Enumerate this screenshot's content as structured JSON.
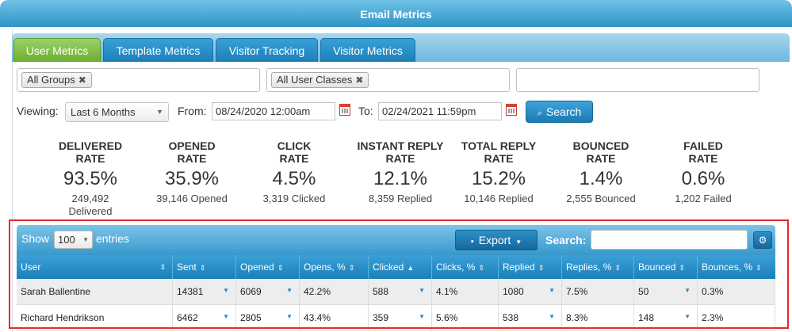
{
  "window": {
    "title": "Email Metrics"
  },
  "tabs": [
    {
      "label": "User Metrics",
      "active": true
    },
    {
      "label": "Template Metrics",
      "active": false
    },
    {
      "label": "Visitor Tracking",
      "active": false
    },
    {
      "label": "Visitor Metrics",
      "active": false
    }
  ],
  "filters": {
    "groups_chip": "All Groups",
    "user_classes_chip": "All User Classes",
    "chip_remove": "✖",
    "third": ""
  },
  "viewing": {
    "label": "Viewing:",
    "selected": "Last 6 Months",
    "from_label": "From:",
    "from_value": "08/24/2020 12:00am",
    "to_label": "To:",
    "to_value": "02/24/2021 11:59pm",
    "search_label": "Search"
  },
  "metrics": [
    {
      "title1": "DELIVERED",
      "title2": "RATE",
      "value": "93.5%",
      "count1": "249,492",
      "count2": "Delivered"
    },
    {
      "title1": "OPENED",
      "title2": "RATE",
      "value": "35.9%",
      "count1": "39,146 Opened",
      "count2": ""
    },
    {
      "title1": "CLICK",
      "title2": "RATE",
      "value": "4.5%",
      "count1": "3,319 Clicked",
      "count2": ""
    },
    {
      "title1": "INSTANT REPLY",
      "title2": "RATE",
      "value": "12.1%",
      "count1": "8,359 Replied",
      "count2": ""
    },
    {
      "title1": "TOTAL REPLY",
      "title2": "RATE",
      "value": "15.2%",
      "count1": "10,146 Replied",
      "count2": ""
    },
    {
      "title1": "BOUNCED",
      "title2": "RATE",
      "value": "1.4%",
      "count1": "2,555 Bounced",
      "count2": ""
    },
    {
      "title1": "FAILED",
      "title2": "RATE",
      "value": "0.6%",
      "count1": "1,202 Failed",
      "count2": ""
    }
  ],
  "table": {
    "show_label": "Show",
    "page_size": "100",
    "entries_label": "entries",
    "export_label": "Export",
    "search_label": "Search:",
    "search_value": "",
    "columns": [
      "User",
      "Sent",
      "Opened",
      "Opens, %",
      "Clicked",
      "Clicks, %",
      "Replied",
      "Replies, %",
      "Bounced",
      "Bounces, %"
    ],
    "sort_icons": [
      "⇕",
      "⇕",
      "⇕",
      "⇕",
      "▲",
      "⇕",
      "⇕",
      "⇕",
      "⇕",
      "⇕"
    ],
    "rows": [
      [
        "Sarah Ballentine",
        "14381",
        "6069",
        "42.2%",
        "588",
        "4.1%",
        "1080",
        "7.5%",
        "50",
        "0.3%"
      ],
      [
        "Richard Hendrikson",
        "6462",
        "2805",
        "43.4%",
        "359",
        "5.6%",
        "538",
        "8.3%",
        "148",
        "2.3%"
      ]
    ]
  },
  "colors": {
    "accent": "#2f95c8",
    "active_tab": "#6cae2f",
    "highlight_border": "#e02b2b"
  }
}
